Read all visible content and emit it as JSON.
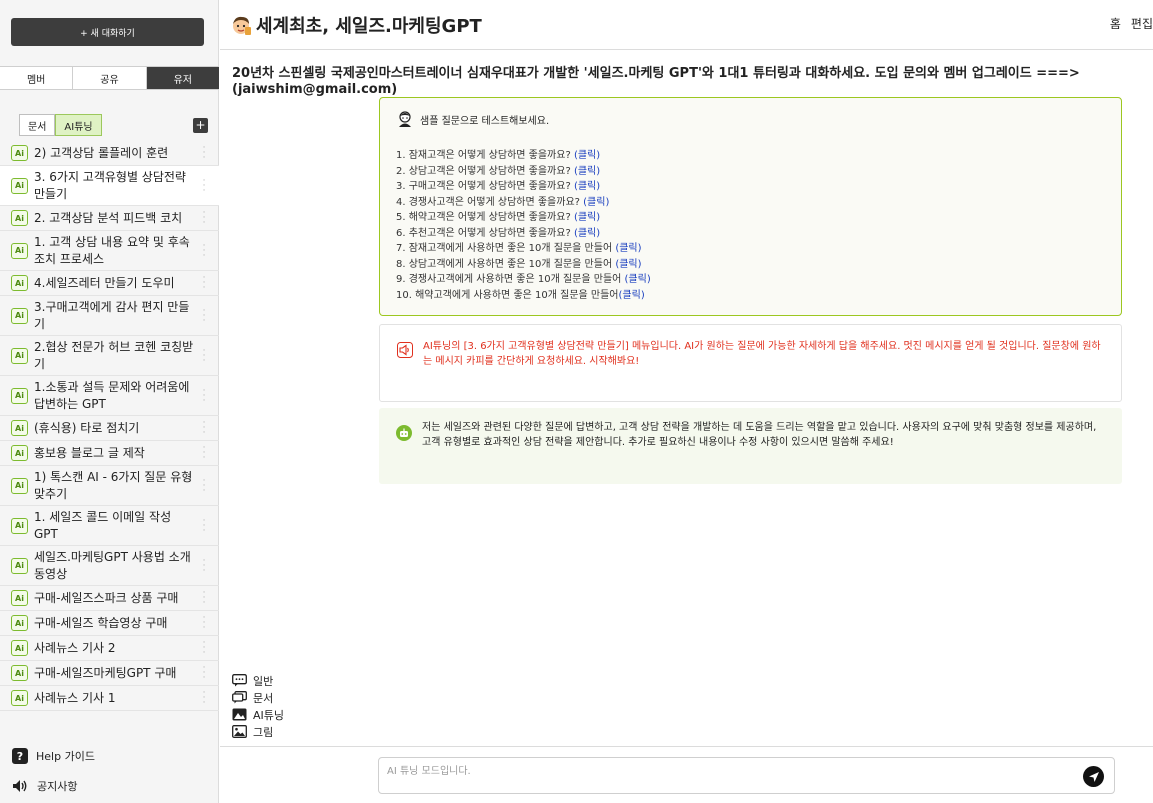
{
  "sidebar": {
    "new_chat_label": "+ 새 대화하기",
    "tabs": [
      {
        "label": "멤버"
      },
      {
        "label": "공유"
      },
      {
        "label": "유저"
      }
    ],
    "subtabs": [
      {
        "label": "문서"
      },
      {
        "label": "AI튜닝"
      }
    ],
    "add_label": "+",
    "badge_label": "Ai",
    "items": [
      {
        "label": "2) 고객상담 롤플레이 훈련"
      },
      {
        "label": "3. 6가지 고객유형별 상담전략 만들기"
      },
      {
        "label": "2. 고객상담 분석 피드백 코치"
      },
      {
        "label": "1. 고객 상담 내용 요약 및 후속 조치 프로세스"
      },
      {
        "label": "4.세일즈레터 만들기 도우미"
      },
      {
        "label": "3.구매고객에게 감사 편지 만들기"
      },
      {
        "label": "2.협상 전문가 허브 코헨 코칭받기"
      },
      {
        "label": "1.소통과 설득 문제와 어려움에 답변하는 GPT"
      },
      {
        "label": "(휴식용) 타로 점치기"
      },
      {
        "label": "홍보용 블로그 글 제작"
      },
      {
        "label": "1) 톡스캔 AI - 6가지 질문 유형 맞추기"
      },
      {
        "label": "1. 세일즈 콜드 이메일 작성 GPT"
      },
      {
        "label": "세일즈.마케팅GPT 사용법 소개 동영상"
      },
      {
        "label": "구매-세일즈스파크 상품 구매"
      },
      {
        "label": "구매-세일즈 학습영상 구매"
      },
      {
        "label": "사례뉴스 기사 2"
      },
      {
        "label": "구매-세일즈마케팅GPT 구매"
      },
      {
        "label": "사례뉴스 기사 1"
      }
    ],
    "help_label": "Help 가이드",
    "notice_label": "공지사항"
  },
  "header": {
    "title": "세계최초, 세일즈.마케팅GPT",
    "home_label": "홈",
    "edit_label": "편집"
  },
  "intro_text": "20년차 스핀셀링 국제공인마스터트레이너 심재우대표가 개발한 '세일즈.마케팅 GPT'와 1대1 튜터링과 대화하세요. 도입 문의와 멤버 업그레이드 ===> (jaiwshim@gmail.com)",
  "samples": {
    "title": "샘플 질문으로 테스트해보세요.",
    "click_label": "(클릭)",
    "questions": [
      "1. 잠재고객은 어떻게 상담하면 좋을까요?",
      "2. 상담고객은 어떻게 상담하면 좋을까요?",
      "3. 구매고객은 어떻게 상담하면 좋을까요?",
      "4. 경쟁사고객은 어떻게 상담하면 좋을까요?",
      "5. 해약고객은 어떻게 상담하면 좋을까요?",
      "6. 추천고객은 어떻게 상담하면 좋을까요?",
      "7. 잠재고객에게 사용하면 좋은 10개 질문을 만들어",
      "8. 상담고객에게 사용하면 좋은 10개 질문을 만들어",
      "9. 경쟁사고객에게 사용하면 좋은 10개 질문을 만들어",
      "10. 해약고객에게 사용하면 좋은 10개 질문을 만들어"
    ]
  },
  "notice_message": "AI튜닝의 [3. 6가지 고객유형별 상담전략 만들기] 메뉴입니다. AI가 원하는 질문에 가능한 자세하게 답을 해주세요. 멋진 메시지를 얻게 될 것입니다. 질문창에 원하는 메시지 카피를 간단하게 요청하세요. 시작해봐요!",
  "bot_message": "저는 세일즈와 관련된 다양한 질문에 답변하고, 고객 상담 전략을 개발하는 데 도움을 드리는 역할을 맡고 있습니다. 사용자의 요구에 맞춰 맞춤형 정보를 제공하며, 고객 유형별로 효과적인 상담 전략을 제안합니다. 추가로 필요하신 내용이나 수정 사항이 있으시면 말씀해 주세요!",
  "modes": [
    {
      "label": "일반"
    },
    {
      "label": "문서"
    },
    {
      "label": "AI튜닝"
    },
    {
      "label": "그림"
    }
  ],
  "composer": {
    "placeholder": "AI 튜닝 모드입니다."
  },
  "colors": {
    "accent_green": "#9cc720",
    "warning_red": "#e0301e",
    "link_blue": "#1a3fbf"
  }
}
